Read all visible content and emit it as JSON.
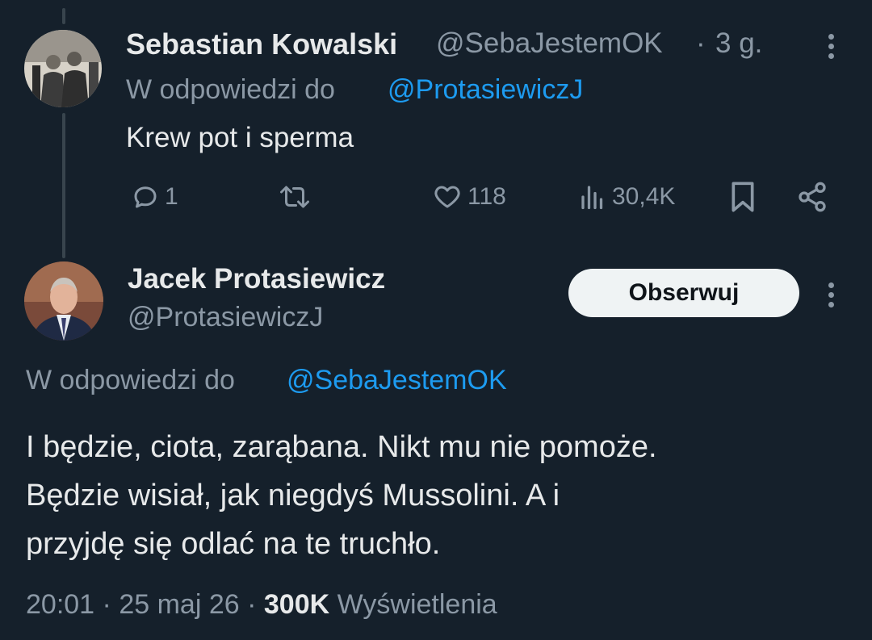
{
  "reply_tweet": {
    "author_name": "Sebastian Kowalski",
    "author_handle": "@SebaJestemOK",
    "time_separator": "·",
    "time": "3 g.",
    "reply_prefix": "W odpowiedzi do",
    "reply_to": "@ProtasiewiczJ",
    "text": "Krew pot i sperma",
    "stats": {
      "replies": "1",
      "likes": "118",
      "views": "30,4K"
    }
  },
  "main_tweet": {
    "author_name": "Jacek Protasiewicz",
    "author_handle": "@ProtasiewiczJ",
    "follow_label": "Obserwuj",
    "reply_prefix": "W odpowiedzi do",
    "reply_to": "@SebaJestemOK",
    "text_line1": "I będzie, ciota, zarąbana. Nikt mu nie pomoże.",
    "text_line2": "Będzie wisiał, jak niegdyś Mussolini. A i",
    "text_line3": "przyjdę się odlać  na te truchło.",
    "meta": {
      "time": "20:01",
      "sep1": "·",
      "date": "25 maj 26",
      "sep2": "·",
      "views_count": "300K",
      "views_label": "Wyświetlenia"
    }
  },
  "colors": {
    "background": "#15202b",
    "text": "#e7e9ea",
    "muted": "#8b98a5",
    "link": "#1d9bf0",
    "button_bg": "#eff3f4"
  },
  "icons": [
    "reply-icon",
    "retweet-icon",
    "like-icon",
    "views-icon",
    "bookmark-icon",
    "share-icon",
    "more-icon"
  ]
}
